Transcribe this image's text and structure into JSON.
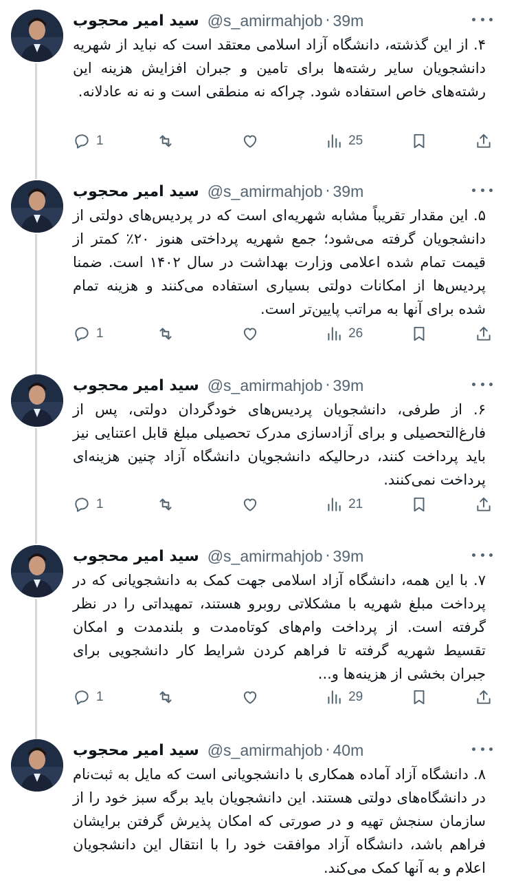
{
  "tweets": [
    {
      "name": "سید امیر محجوب",
      "handle": "@s_amirmahjob",
      "time": "39m",
      "text": "۴. از این گذشته، دانشگاه آزاد اسلامی معتقد است که نباید از شهریه دانشجویان سایر رشته‌ها برای تامین و جبران افزایش هزینه این رشته‌های خاص استفاده شود. چراکه نه منطقی است و نه نه عادلانه.",
      "replies": "1",
      "reposts": "",
      "likes": "",
      "views": "25"
    },
    {
      "name": "سید امیر محجوب",
      "handle": "@s_amirmahjob",
      "time": "39m",
      "text": "۵. این مقدار تقریباً مشابه شهریه‌ای است که در پردیس‌های دولتی از دانشجویان گرفته می‌شود؛ جمع شهریه پرداختی هنوز ۲۰٪ کمتر از قیمت تمام شده اعلامی وزارت بهداشت در سال ۱۴۰۲ است. ضمنا پردیس‌ها از امکانات دولتی بسیاری استفاده می‌کنند و هزینه تمام شده برای آنها به مراتب پایین‌تر است.",
      "replies": "1",
      "reposts": "",
      "likes": "",
      "views": "26"
    },
    {
      "name": "سید امیر محجوب",
      "handle": "@s_amirmahjob",
      "time": "39m",
      "text": "۶. از طرفی، دانشجویان پردیس‌های خودگردان دولتی، پس از فارغ‌التحصیلی و برای آزادسازی مدرک تحصیلی مبلغ قابل اعتنایی نیز باید پرداخت کنند، درحالیکه دانشجویان دانشگاه آزاد چنین هزینه‌ای پرداخت نمی‌کنند.",
      "replies": "1",
      "reposts": "",
      "likes": "",
      "views": "21"
    },
    {
      "name": "سید امیر محجوب",
      "handle": "@s_amirmahjob",
      "time": "39m",
      "text": "۷. با این همه، دانشگاه آزاد اسلامی جهت کمک به دانشجویانی که در پرداخت مبلغ شهریه با مشکلاتی روبرو هستند، تمهیداتی را در نظر گرفته است. از پرداخت وام‌های کوتاه‌مدت و بلندمدت و امکان تقسیط شهریه گرفته تا فراهم کردن شرایط کار دانشجویی برای جبران بخشی از هزینه‌ها و...",
      "replies": "1",
      "reposts": "",
      "likes": "",
      "views": "29"
    },
    {
      "name": "سید امیر محجوب",
      "handle": "@s_amirmahjob",
      "time": "40m",
      "text": "۸. دانشگاه آزاد آماده همکاری با دانشجویانی است که مایل به ثبت‌نام در دانشگاه‌های دولتی هستند. این دانشجویان باید برگه سبز خود را از سازمان سنجش تهیه و در صورتی که امکان پذیرش گرفتن برایشان فراهم باشد، دانشگاه آزاد موافقت خود را با انتقال این دانشجویان اعلام و به آنها کمک می‌کند.",
      "replies": "",
      "reposts": "",
      "likes": "",
      "views": ""
    }
  ],
  "separator": "·",
  "icons": [
    "more-icon",
    "reply-icon",
    "repost-icon",
    "like-icon",
    "views-icon",
    "bookmark-icon",
    "share-icon"
  ],
  "colors": {
    "text": "#0f1419",
    "muted": "#536471",
    "thread_line": "#cfd9de",
    "background": "#ffffff"
  }
}
